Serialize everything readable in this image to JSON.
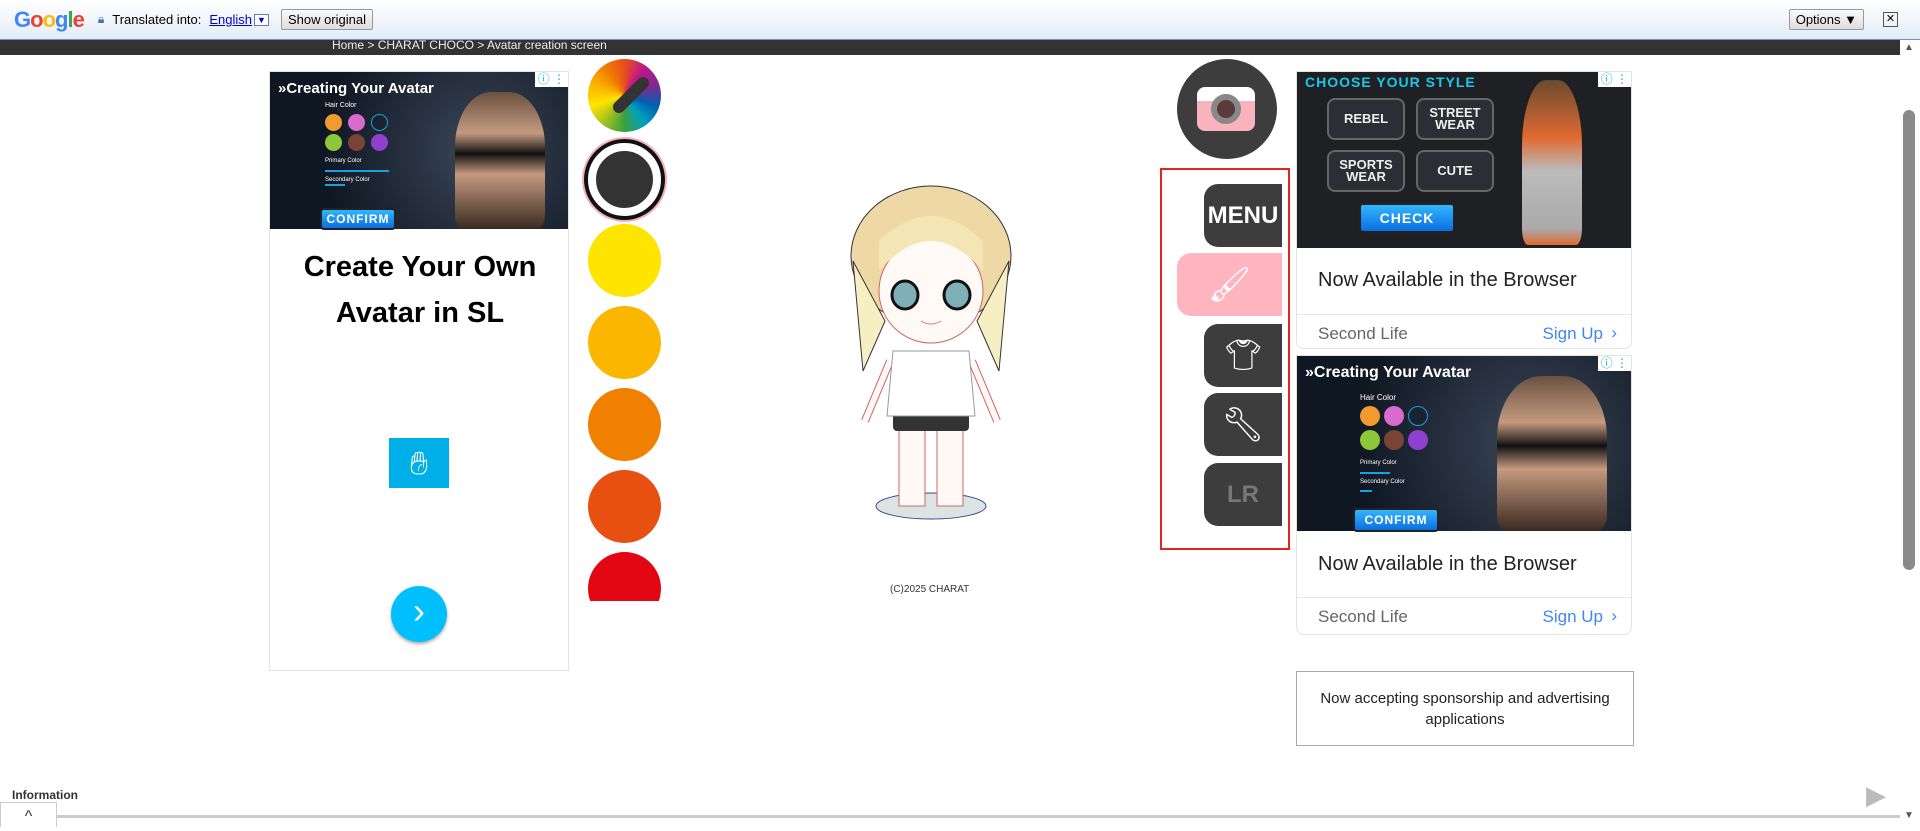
{
  "translate_bar": {
    "logo": "Google",
    "translated_into": "Translated into:",
    "language": "English",
    "show_original": "Show original",
    "options": "Options ▼",
    "close": "✕"
  },
  "breadcrumb": {
    "home": "Home",
    "sep": ">",
    "section": "CHARAT CHOCO",
    "page": "Avatar creation screen"
  },
  "left_ad": {
    "image_heading": "»Creating Your Avatar",
    "hair_color": "Hair Color",
    "primary": "Primary Color",
    "secondary": "Secondary Color",
    "confirm": "CONFIRM",
    "headline": "Create Your Own Avatar in SL",
    "next": "›"
  },
  "palette": {
    "colors": [
      "#ffe400",
      "#fbb600",
      "#f08000",
      "#e85012",
      "#e30613"
    ],
    "selected": "#333333"
  },
  "copyright": "(C)2025 CHARAT",
  "menu": {
    "menu_label": "MENU",
    "items": [
      "paint",
      "clothes",
      "tools",
      "left-right"
    ],
    "active": "paint",
    "lr_label": "LR"
  },
  "right_ad_1": {
    "heading": "CHOOSE YOUR STYLE",
    "styles": [
      "REBEL",
      "STREET WEAR",
      "SPORTS WEAR",
      "CUTE"
    ],
    "check": "CHECK",
    "title": "Now Available in the Browser",
    "brand": "Second Life",
    "cta": "Sign Up"
  },
  "right_ad_2": {
    "image_heading": "»Creating Your Avatar",
    "hair_color": "Hair Color",
    "primary": "Primary Color",
    "secondary": "Secondary Color",
    "confirm": "CONFIRM",
    "title": "Now Available in the Browser",
    "brand": "Second Life",
    "cta": "Sign Up"
  },
  "sponsor": "Now accepting sponsorship and advertising applications",
  "footer": {
    "information": "Information",
    "up": "^"
  }
}
